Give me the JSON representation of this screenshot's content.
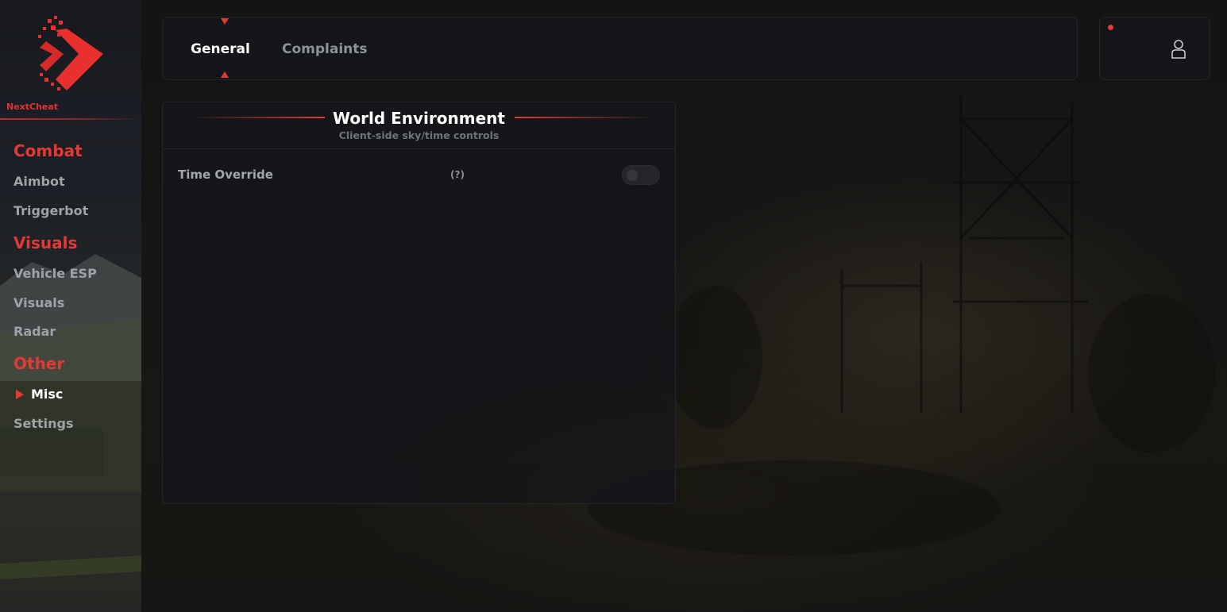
{
  "app": {
    "brand": "NextCheat",
    "accent_color": "#e53935"
  },
  "sidebar": {
    "sections": [
      {
        "title": "Combat",
        "items": [
          "Aimbot",
          "Triggerbot"
        ]
      },
      {
        "title": "Visuals",
        "items": [
          "Vehicle ESP",
          "Visuals",
          "Radar"
        ]
      },
      {
        "title": "Other",
        "items": [
          "Misc",
          "Settings"
        ]
      }
    ],
    "active_item": "Misc"
  },
  "tabs": [
    {
      "label": "General",
      "active": true
    },
    {
      "label": "Complaints",
      "active": false
    }
  ],
  "profile": {
    "icon": "user-icon",
    "status_dot_color": "#e53935"
  },
  "panel": {
    "title": "World Environment",
    "subtitle": "Client-side sky/time controls",
    "options": [
      {
        "label": "Time Override",
        "help": "(?)",
        "enabled": false
      }
    ]
  }
}
